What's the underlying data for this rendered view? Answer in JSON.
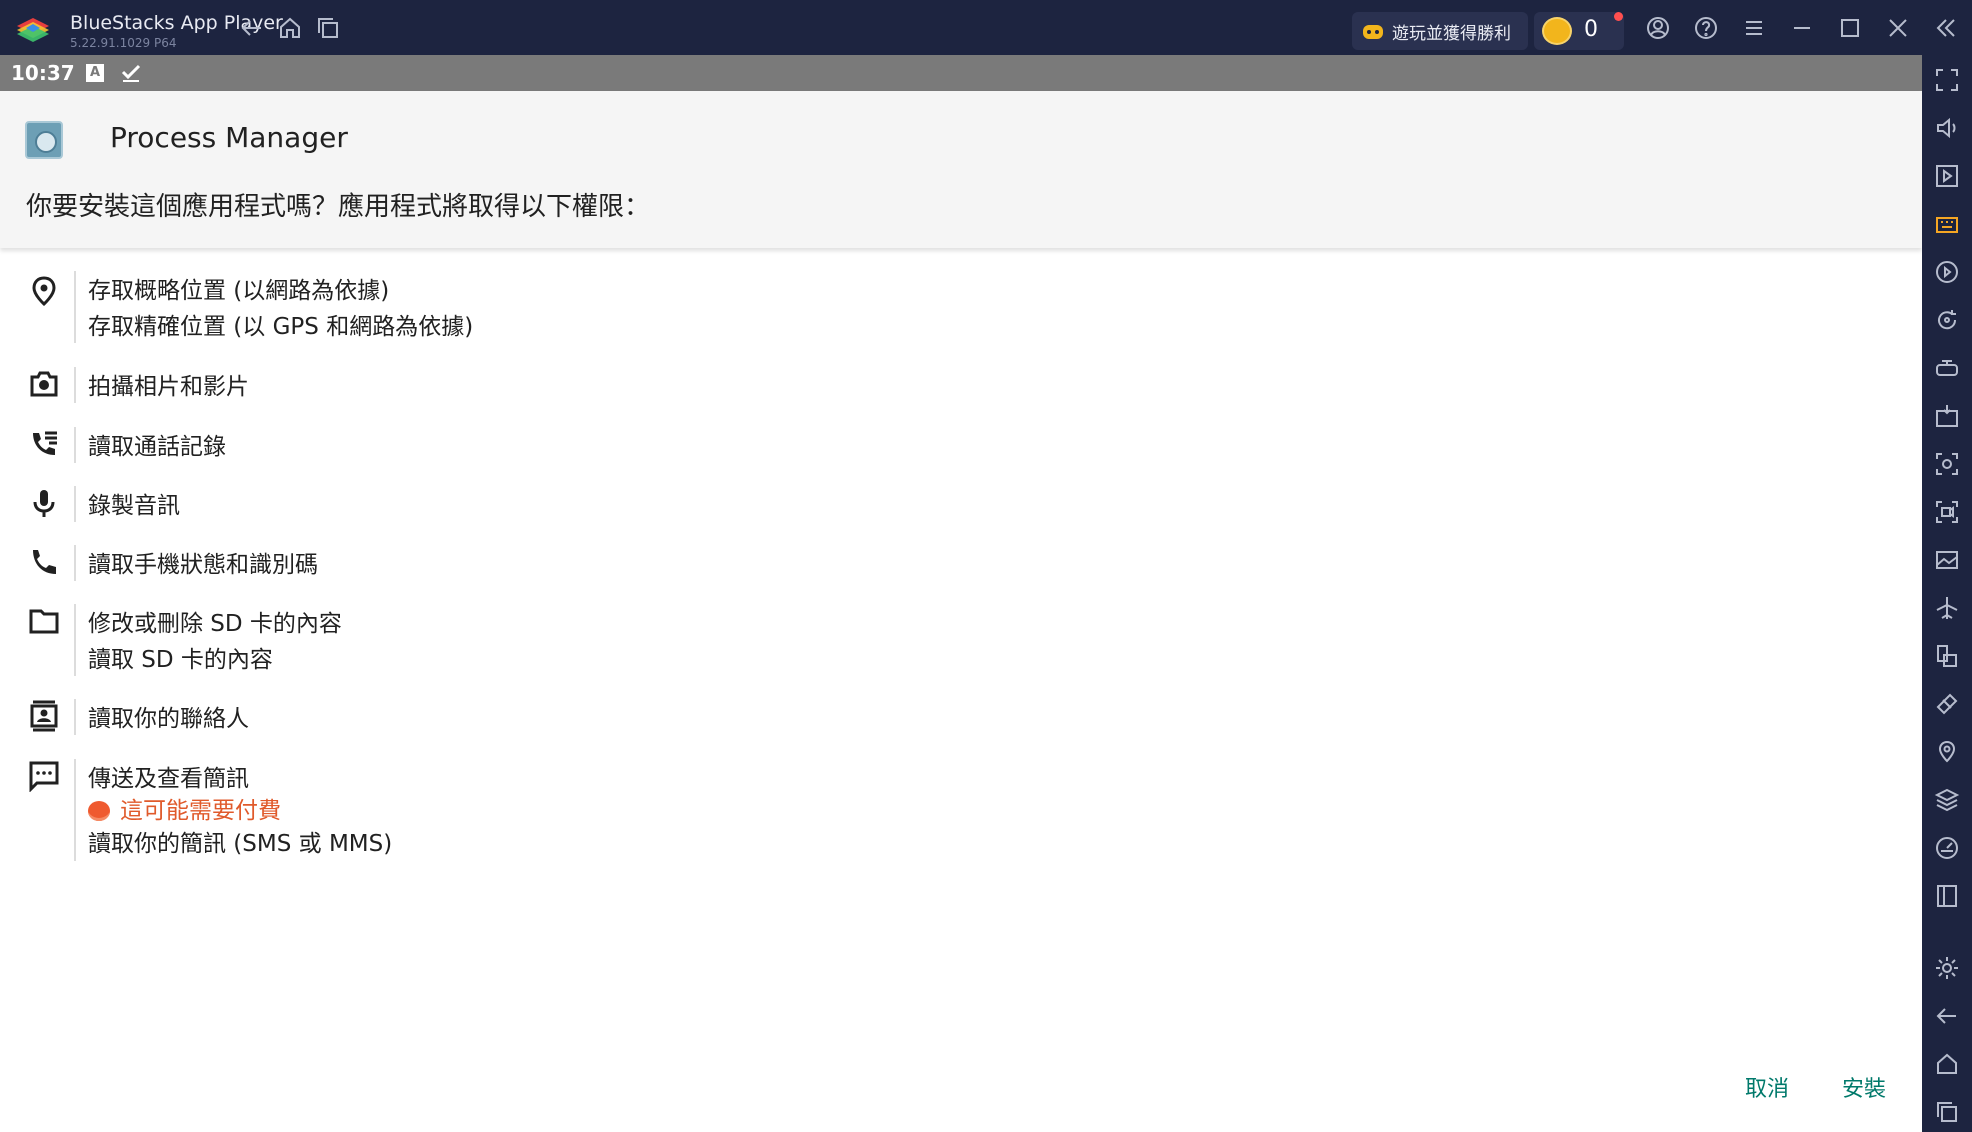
{
  "window": {
    "app_name": "BlueStacks App Player",
    "version": "5.22.91.1029  P64",
    "promo_label": "遊玩並獲得勝利",
    "coin_count": "0"
  },
  "statusbar": {
    "time": "10:37",
    "a_badge": "A"
  },
  "dialog": {
    "app_title": "Process Manager",
    "question": "你要安裝這個應用程式嗎？應用程式將取得以下權限：",
    "permissions": [
      {
        "icon": "location-pin-icon",
        "lines": [
          "存取概略位置 (以網路為依據)",
          "存取精確位置 (以 GPS 和網路為依據)"
        ]
      },
      {
        "icon": "camera-icon",
        "lines": [
          "拍攝相片和影片"
        ]
      },
      {
        "icon": "call-log-icon",
        "lines": [
          "讀取通話記錄"
        ]
      },
      {
        "icon": "microphone-icon",
        "lines": [
          "錄製音訊"
        ]
      },
      {
        "icon": "phone-icon",
        "lines": [
          "讀取手機狀態和識別碼"
        ]
      },
      {
        "icon": "folder-icon",
        "lines": [
          "修改或刪除 SD 卡的內容",
          "讀取 SD 卡的內容"
        ]
      },
      {
        "icon": "contacts-icon",
        "lines": [
          "讀取你的聯絡人"
        ]
      },
      {
        "icon": "sms-icon",
        "lines": [
          "傳送及查看簡訊",
          "讀取你的簡訊 (SMS 或 MMS)"
        ],
        "warning": "這可能需要付費"
      }
    ],
    "cancel_label": "取消",
    "install_label": "安裝"
  },
  "colors": {
    "accent": "#00796b",
    "warning": "#e05a2b",
    "titlebar": "#1d2440"
  }
}
